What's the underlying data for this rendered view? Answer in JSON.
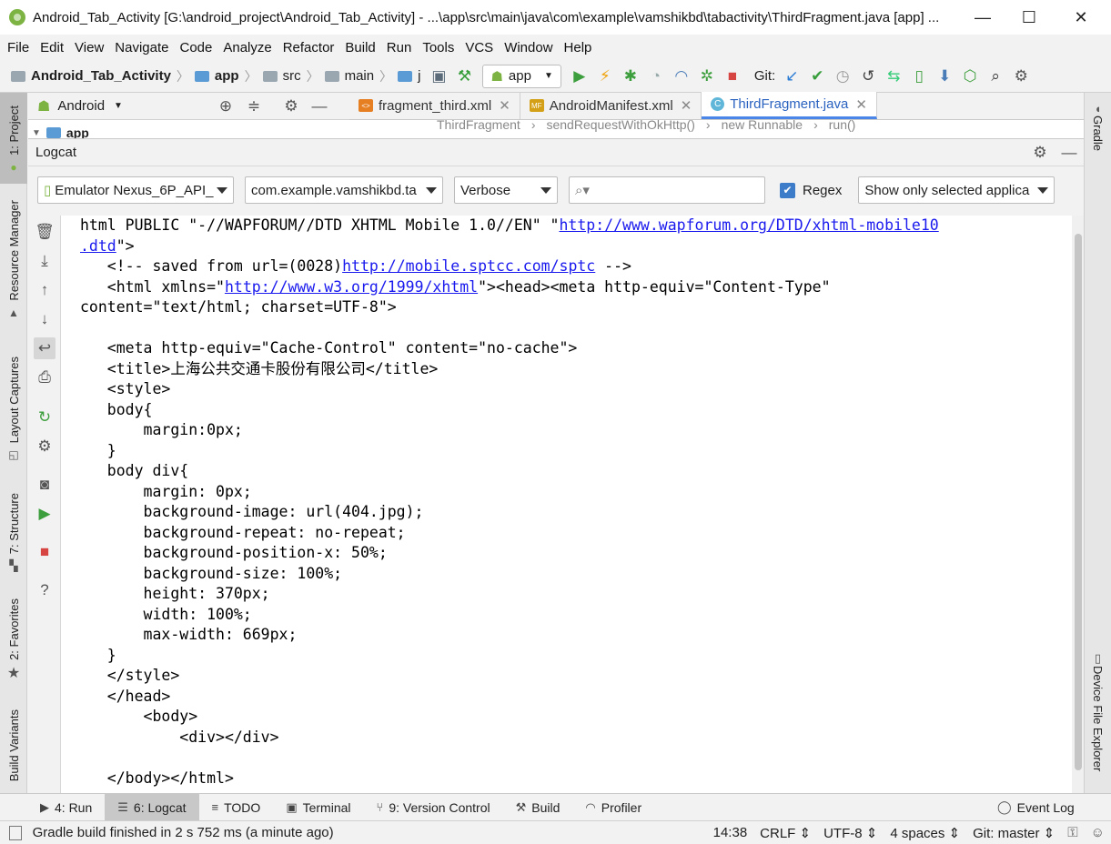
{
  "window": {
    "title": "Android_Tab_Activity [G:\\android_project\\Android_Tab_Activity] - ...\\app\\src\\main\\java\\com\\example\\vamshikbd\\tabactivity\\ThirdFragment.java [app] ...",
    "minimize": "—",
    "maximize": "☐",
    "close": "✕"
  },
  "menu": [
    "File",
    "Edit",
    "View",
    "Navigate",
    "Code",
    "Analyze",
    "Refactor",
    "Build",
    "Run",
    "Tools",
    "VCS",
    "Window",
    "Help"
  ],
  "breadcrumbs": {
    "project": "Android_Tab_Activity",
    "module": "app",
    "src": "src",
    "main": "main",
    "java": "j"
  },
  "toolbar": {
    "run_config": "app",
    "git_label": "Git:"
  },
  "left_stripe": {
    "project": "1: Project",
    "resource_manager": "Resource Manager",
    "layout_captures": "Layout Captures",
    "structure": "7: Structure",
    "favorites": "2: Favorites",
    "build_variants": "Build Variants"
  },
  "right_stripe": {
    "gradle": "Gradle",
    "device_file_explorer": "Device File Explorer"
  },
  "project_panel": {
    "view_mode": "Android",
    "root_item": "app"
  },
  "editor_tabs": [
    {
      "label": "fragment_third.xml",
      "icon": "<>"
    },
    {
      "label": "AndroidManifest.xml",
      "icon": "MF"
    },
    {
      "label": "ThirdFragment.java",
      "icon": "C"
    }
  ],
  "editor_breadcrumb": [
    "ThirdFragment",
    "sendRequestWithOkHttp()",
    "new Runnable",
    "run()"
  ],
  "logcat": {
    "title": "Logcat",
    "device": "Emulator Nexus_6P_API_",
    "process": "com.example.vamshikbd.ta",
    "level": "Verbose",
    "search_placeholder": "",
    "regex_label": "Regex",
    "regex_checked": true,
    "filter": "Show only selected applica"
  },
  "log_lines": [
    {
      "segments": [
        {
          "t": "html PUBLIC \"-//WAPFORUM//DTD XHTML Mobile 1.0//EN\" \""
        },
        {
          "t": "http://www.wapforum.org/DTD/xhtml-mobile10",
          "link": true
        }
      ]
    },
    {
      "segments": [
        {
          "t": ".dtd",
          "link": true
        },
        {
          "t": "\">"
        }
      ]
    },
    {
      "segments": [
        {
          "t": "   <!-- saved from url=(0028)"
        },
        {
          "t": "http://mobile.sptcc.com/sptc",
          "link": true
        },
        {
          "t": " -->"
        }
      ]
    },
    {
      "segments": [
        {
          "t": "   <html xmlns=\""
        },
        {
          "t": "http://www.w3.org/1999/xhtml",
          "link": true
        },
        {
          "t": "\"><head><meta http-equiv=\"Content-Type\""
        }
      ]
    },
    {
      "segments": [
        {
          "t": "content=\"text/html; charset=UTF-8\">"
        }
      ]
    },
    {
      "segments": [
        {
          "t": ""
        }
      ]
    },
    {
      "segments": [
        {
          "t": "   <meta http-equiv=\"Cache-Control\" content=\"no-cache\">"
        }
      ]
    },
    {
      "segments": [
        {
          "t": "   <title>上海公共交通卡股份有限公司</title>"
        }
      ]
    },
    {
      "segments": [
        {
          "t": "   <style>"
        }
      ]
    },
    {
      "segments": [
        {
          "t": "   body{"
        }
      ]
    },
    {
      "segments": [
        {
          "t": "       margin:0px;"
        }
      ]
    },
    {
      "segments": [
        {
          "t": "   }"
        }
      ]
    },
    {
      "segments": [
        {
          "t": "   body div{"
        }
      ]
    },
    {
      "segments": [
        {
          "t": "       margin: 0px;"
        }
      ]
    },
    {
      "segments": [
        {
          "t": "       background-image: url(404.jpg);"
        }
      ]
    },
    {
      "segments": [
        {
          "t": "       background-repeat: no-repeat;"
        }
      ]
    },
    {
      "segments": [
        {
          "t": "       background-position-x: 50%;"
        }
      ]
    },
    {
      "segments": [
        {
          "t": "       background-size: 100%;"
        }
      ]
    },
    {
      "segments": [
        {
          "t": "       height: 370px;"
        }
      ]
    },
    {
      "segments": [
        {
          "t": "       width: 100%;"
        }
      ]
    },
    {
      "segments": [
        {
          "t": "       max-width: 669px;"
        }
      ]
    },
    {
      "segments": [
        {
          "t": "   }"
        }
      ]
    },
    {
      "segments": [
        {
          "t": "   </style>"
        }
      ]
    },
    {
      "segments": [
        {
          "t": "   </head>"
        }
      ]
    },
    {
      "segments": [
        {
          "t": "       <body>"
        }
      ]
    },
    {
      "segments": [
        {
          "t": "           <div></div>"
        }
      ]
    },
    {
      "segments": [
        {
          "t": ""
        }
      ]
    },
    {
      "segments": [
        {
          "t": "   </body></html>"
        }
      ]
    }
  ],
  "bottom_tabs": [
    {
      "label": "4: Run",
      "icon": "▶",
      "active": false
    },
    {
      "label": "6: Logcat",
      "icon": "☰",
      "active": true
    },
    {
      "label": "TODO",
      "icon": "≡",
      "active": false
    },
    {
      "label": "Terminal",
      "icon": "▣",
      "active": false
    },
    {
      "label": "9: Version Control",
      "icon": "⑂",
      "active": false
    },
    {
      "label": "Build",
      "icon": "⚒",
      "active": false
    },
    {
      "label": "Profiler",
      "icon": "◠",
      "active": false
    }
  ],
  "event_log": "Event Log",
  "status": {
    "message": "Gradle build finished in 2 s 752 ms (a minute ago)",
    "position": "14:38",
    "line_sep": "CRLF",
    "encoding": "UTF-8",
    "indent": "4 spaces",
    "git_branch": "Git: master"
  }
}
